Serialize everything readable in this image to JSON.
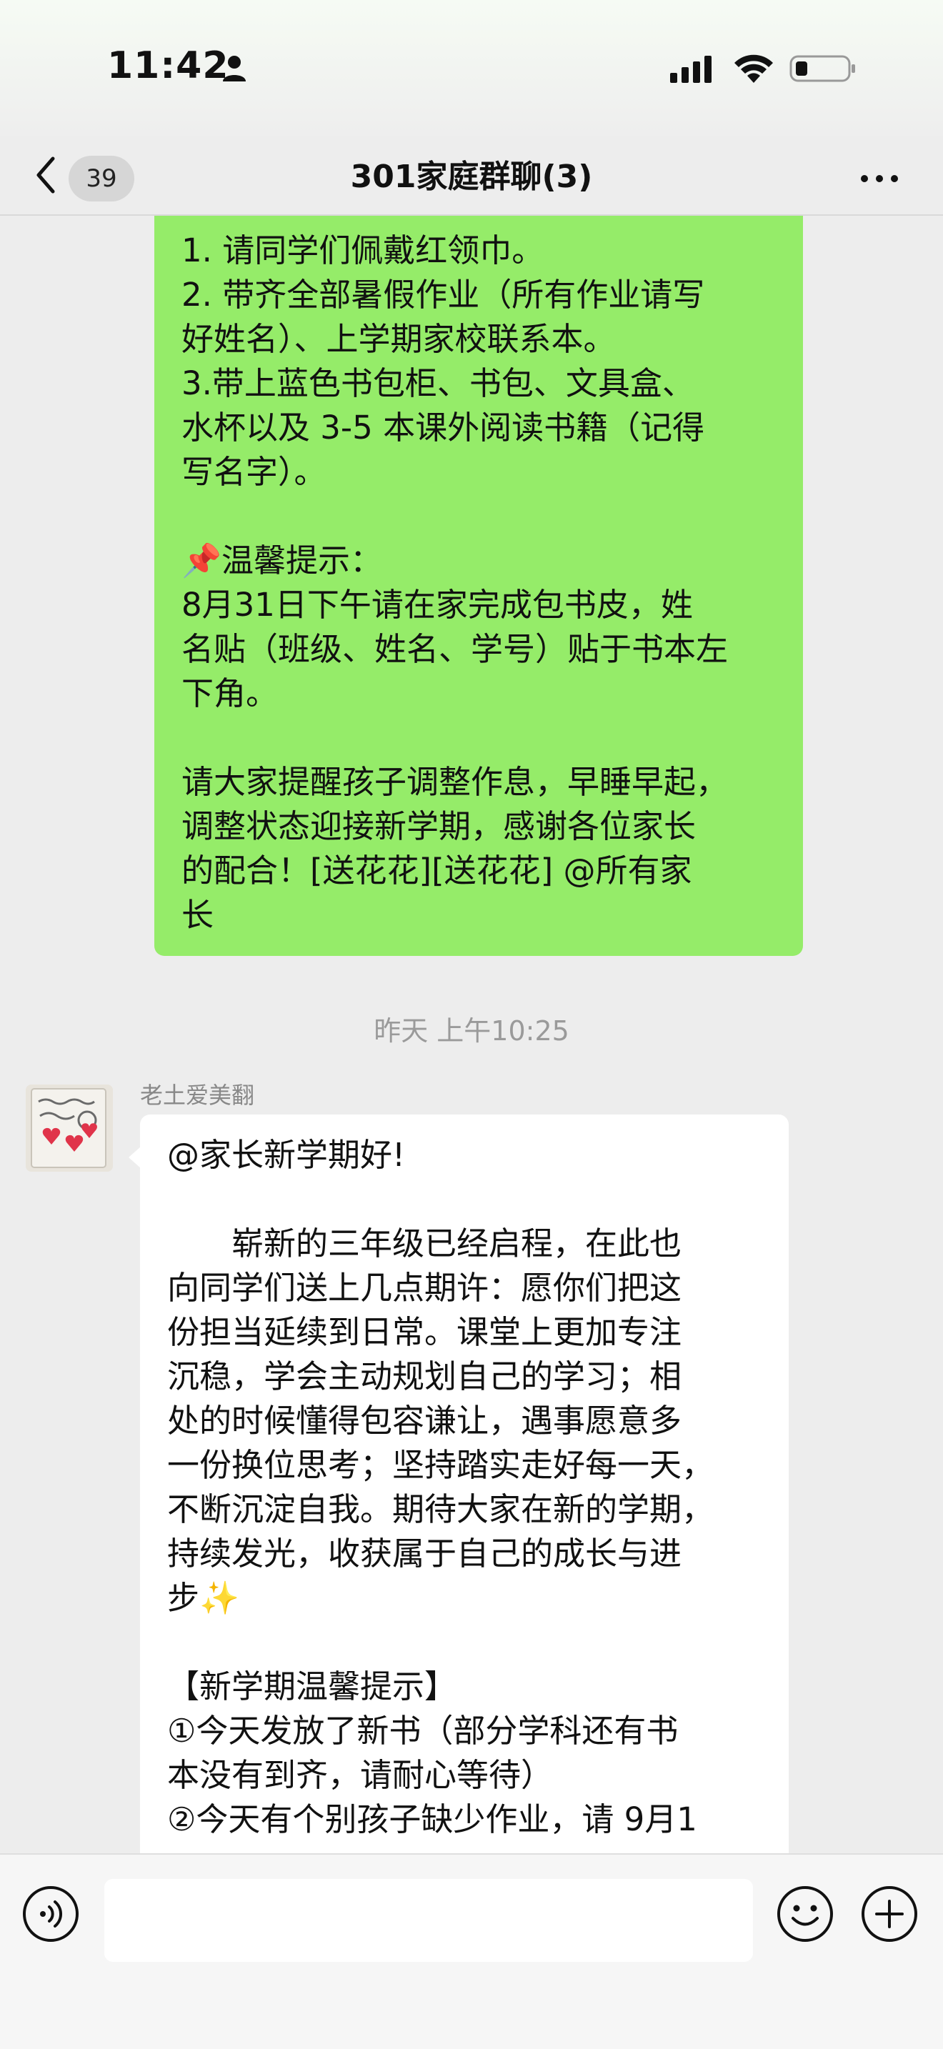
{
  "status_bar": {
    "time": "11:42"
  },
  "header": {
    "unread_count": "39",
    "title": "301家庭群聊(3)"
  },
  "messages": [
    {
      "side": "right",
      "lines": [
        "1. 请同学们佩戴红领巾。",
        "2. 带齐全部暑假作业（所有作业请写",
        "好姓名）、上学期家校联系本。",
        "3.带上蓝色书包柜、书包、文具盒、",
        "水杯以及 3-5 本课外阅读书籍（记得",
        "写名字）。",
        "",
        "📌温馨提示：",
        "8月31日下午请在家完成包书皮，姓",
        "名贴（班级、姓名、学号）贴于书本左",
        "下角。",
        "",
        "请大家提醒孩子调整作息，早睡早起，",
        "调整状态迎接新学期，感谢各位家长",
        "的配合！[送花花][送花花] @所有家",
        "长"
      ]
    },
    {
      "side": "left",
      "sender": "老土爱美翻",
      "lines": [
        "@家长新学期好!",
        "",
        "崭新的三年级已经启程，在此也",
        "向同学们送上几点期许：愿你们把这",
        "份担当延续到日常。课堂上更加专注",
        "沉稳，学会主动规划自己的学习；相",
        "处的时候懂得包容谦让，遇事愿意多",
        "一份换位思考；坚持踏实走好每一天，",
        "不断沉淀自我。期待大家在新的学期，",
        "持续发光，收获属于自己的成长与进",
        "步✨",
        "",
        "【新学期温馨提示】",
        "①今天发放了新书（部分学科还有书",
        "本没有到齐，请耐心等待）",
        "②今天有个别孩子缺少作业，请 9月1"
      ]
    }
  ],
  "time_divider": "昨天 上午10:25",
  "icons": {
    "back": "chevron-left-icon",
    "more": "more-icon",
    "voice": "voice-icon",
    "emoji": "emoji-icon",
    "add": "plus-icon"
  },
  "colors": {
    "self_bubble": "#95ec69",
    "other_bubble": "#ffffff",
    "background": "#ededed"
  }
}
